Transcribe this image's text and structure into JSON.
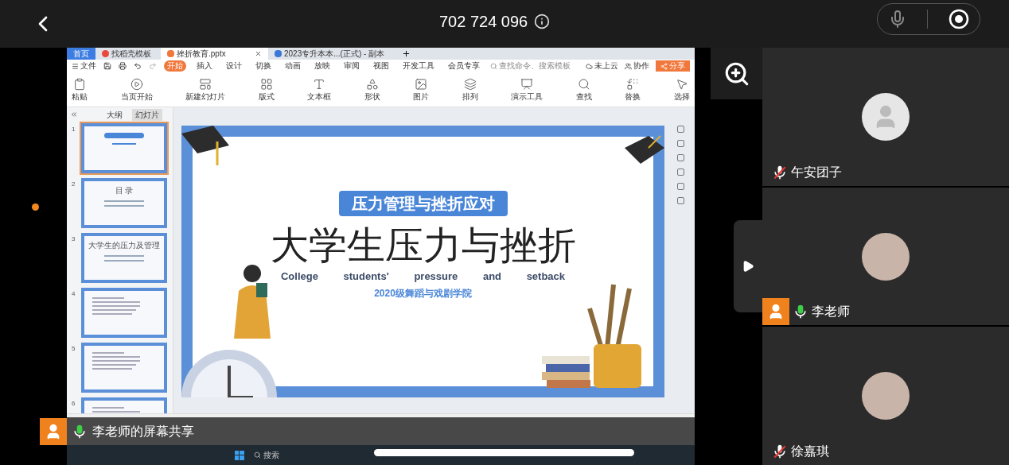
{
  "call": {
    "meeting_id": "702 724 096"
  },
  "shared_screen": {
    "tabs": [
      {
        "label": "首页",
        "kind": "home",
        "selected": false
      },
      {
        "label": "找稻壳模板",
        "kind": "template",
        "selected": false
      },
      {
        "label": "挫折教育.pptx",
        "kind": "slides",
        "selected": true
      },
      {
        "label": "2023专升本本...(正式) - 副本",
        "kind": "sheet",
        "selected": false
      }
    ],
    "file_menu": "文件",
    "menu": [
      {
        "label": "开始",
        "selected": true
      },
      {
        "label": "插入",
        "selected": false
      },
      {
        "label": "设计",
        "selected": false
      },
      {
        "label": "切换",
        "selected": false
      },
      {
        "label": "动画",
        "selected": false
      },
      {
        "label": "放映",
        "selected": false
      },
      {
        "label": "审阅",
        "selected": false
      },
      {
        "label": "视图",
        "selected": false
      },
      {
        "label": "开发工具",
        "selected": false
      },
      {
        "label": "会员专享",
        "selected": false
      }
    ],
    "search_placeholder": "查找命令、搜索模板",
    "cloud": "未上云",
    "collab": "协作",
    "share": "分享",
    "ribbon": [
      "粘贴",
      "当页开始",
      "新建幻灯片",
      "版式",
      "文本框",
      "形状",
      "图片",
      "排列",
      "演示工具",
      "查找",
      "替换",
      "选择"
    ],
    "pane_tabs": [
      {
        "label": "大纲",
        "selected": false
      },
      {
        "label": "幻灯片",
        "selected": true
      }
    ],
    "thumbnails": [
      {
        "number": "1",
        "selected": true,
        "kind": "cover"
      },
      {
        "number": "2",
        "selected": false,
        "kind": "contents",
        "title": "目 录"
      },
      {
        "number": "3",
        "selected": false,
        "kind": "chapter",
        "title": "大学生的压力及管理"
      },
      {
        "number": "4",
        "selected": false,
        "kind": "text"
      },
      {
        "number": "5",
        "selected": false,
        "kind": "text"
      },
      {
        "number": "6",
        "selected": false,
        "kind": "text"
      }
    ],
    "slide": {
      "badge": "压力管理与挫折应对",
      "title": "大学生压力与挫折",
      "subtitle_en": "College students' pressure and setback",
      "subtitle": "2020级舞蹈与戏剧学院"
    },
    "taskbar_search": "搜索"
  },
  "share_banner": "李老师的屏幕共享",
  "participants": [
    {
      "name": "午安团子",
      "muted": true,
      "host": false,
      "photo": false
    },
    {
      "name": "李老师",
      "muted": false,
      "host": true,
      "photo": true
    },
    {
      "name": "徐嘉琪",
      "muted": true,
      "host": false,
      "photo": true
    }
  ]
}
